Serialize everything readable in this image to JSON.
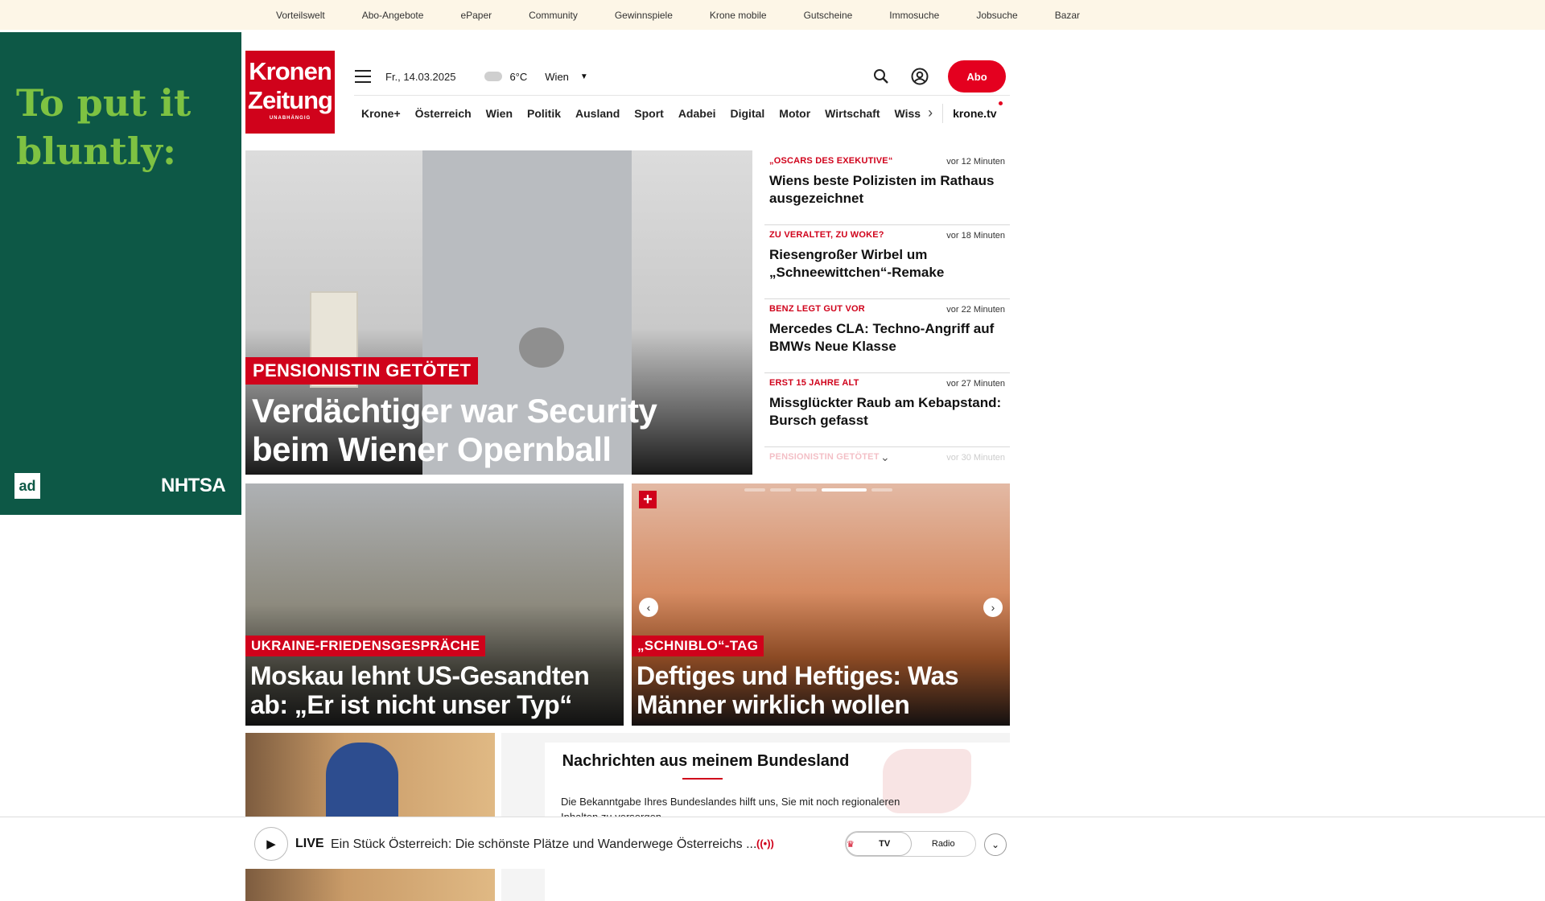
{
  "topbar": {
    "items": [
      "Vorteilswelt",
      "Abo-Angebote",
      "ePaper",
      "Community",
      "Gewinnspiele",
      "Krone mobile",
      "Gutscheine",
      "Immosuche",
      "Jobsuche",
      "Bazar"
    ]
  },
  "ad": {
    "headline": "To put it bluntly:",
    "logo_left": "ad",
    "logo_right": "NHTSA"
  },
  "header": {
    "logo_line1": "Kronen",
    "logo_line2": "Zeitung",
    "logo_sub": "UNABHÄNGIG",
    "date": "Fr., 14.03.2025",
    "temperature": "6°C",
    "city": "Wien",
    "abo_label": "Abo"
  },
  "nav": {
    "items": [
      "Krone+",
      "Österreich",
      "Wien",
      "Politik",
      "Ausland",
      "Sport",
      "Adabei",
      "Digital",
      "Motor",
      "Wirtschaft"
    ],
    "faded_item": "Wiss",
    "tv": "krone.tv"
  },
  "hero": {
    "kicker": "PENSIONISTIN GETÖTET",
    "title": "Verdächtiger war Security beim Wiener Opernball"
  },
  "side_stories": [
    {
      "kicker": "„OSCARS DES EXEKUTIVE“",
      "time": "vor 12 Minuten",
      "headline": "Wiens beste Polizisten im Rathaus ausgezeichnet"
    },
    {
      "kicker": "ZU VERALTET, ZU WOKE?",
      "time": "vor 18 Minuten",
      "headline": "Riesengroßer Wirbel um „Schneewittchen“-Remake"
    },
    {
      "kicker": "BENZ LEGT GUT VOR",
      "time": "vor 22 Minuten",
      "headline": "Mercedes CLA: Techno-Angriff auf BMWs Neue Klasse"
    },
    {
      "kicker": "ERST 15 JAHRE ALT",
      "time": "vor 27 Minuten",
      "headline": "Missglückter Raub am Kebapstand: Bursch gefasst"
    },
    {
      "kicker": "PENSIONISTIN GETÖTET",
      "time": "vor 30 Minuten",
      "headline": ""
    }
  ],
  "cards": [
    {
      "kicker": "UKRAINE-FRIEDENSGESPRÄCHE",
      "title": "Moskau lehnt US-Gesandten ab: „Er ist nicht unser Typ“"
    },
    {
      "kicker": "„SCHNIBLO“-TAG",
      "title": "Deftiges und Heftiges: Was Männer wirklich wollen"
    }
  ],
  "bundesland": {
    "heading": "Nachrichten aus meinem Bundesland",
    "text": "Die Bekanntgabe Ihres Bundeslandes hilft uns, Sie mit noch regionaleren Inhalten zu versorgen."
  },
  "player": {
    "live_label": "LIVE",
    "title": "Ein Stück Österreich: Die schönste Plätze und Wanderwege Österreichs ...",
    "tv_label": "TV",
    "radio_label": "Radio"
  },
  "colors": {
    "brand_red": "#d0021b",
    "ad_green": "#0d5846",
    "ad_text_green": "#7ec242",
    "topbar_bg": "#fdf6e7"
  }
}
